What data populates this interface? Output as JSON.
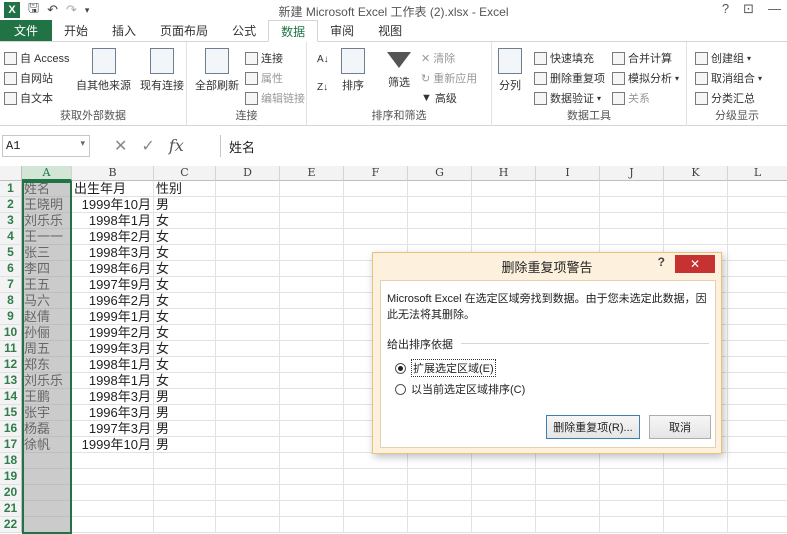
{
  "app": {
    "title": "新建 Microsoft Excel 工作表 (2).xlsx - Excel",
    "logo": "X",
    "window_controls": [
      "?",
      "⊡",
      "—"
    ]
  },
  "qat": {
    "save_icon": "save-icon",
    "undo_icon": "undo-icon",
    "redo_icon": "redo-icon",
    "customize_icon": "customize-qat-icon"
  },
  "tabs": [
    {
      "label": "文件"
    },
    {
      "label": "开始"
    },
    {
      "label": "插入"
    },
    {
      "label": "页面布局"
    },
    {
      "label": "公式"
    },
    {
      "label": "数据"
    },
    {
      "label": "审阅"
    },
    {
      "label": "视图"
    }
  ],
  "ribbon": {
    "external": {
      "from_access": "自 Access",
      "from_web": "自网站",
      "from_text": "自文本",
      "other_sources": "自其他来源",
      "existing_conn": "现有连接",
      "label": "获取外部数据"
    },
    "connections": {
      "refresh_all": "全部刷新",
      "connections": "连接",
      "properties": "属性",
      "edit_links": "编辑链接",
      "label": "连接"
    },
    "sort_filter": {
      "sort": "排序",
      "filter": "筛选",
      "clear": "清除",
      "reapply": "重新应用",
      "advanced": "高级",
      "label": "排序和筛选"
    },
    "data_tools": {
      "text_to_columns": "分列",
      "flash_fill": "快速填充",
      "remove_duplicates": "删除重复项",
      "data_validation": "数据验证",
      "consolidate": "合并计算",
      "what_if": "模拟分析",
      "relationships": "关系",
      "label": "数据工具"
    },
    "outline": {
      "group": "创建组",
      "ungroup": "取消组合",
      "subtotal": "分类汇总",
      "label": "分级显示"
    }
  },
  "formula_bar": {
    "name_box": "A1",
    "fx": "fx",
    "content": "姓名"
  },
  "columns": [
    "A",
    "B",
    "C",
    "D",
    "E",
    "F",
    "G",
    "H",
    "I",
    "J",
    "K",
    "L"
  ],
  "rows": [
    {
      "n": "1",
      "a": "姓名",
      "b": "出生年月",
      "c": "性别"
    },
    {
      "n": "2",
      "a": "王晓明",
      "b": "1999年10月",
      "c": "男"
    },
    {
      "n": "3",
      "a": "刘乐乐",
      "b": "1998年1月",
      "c": "女"
    },
    {
      "n": "4",
      "a": "王一一",
      "b": "1998年2月",
      "c": "女"
    },
    {
      "n": "5",
      "a": "张三",
      "b": "1998年3月",
      "c": "女"
    },
    {
      "n": "6",
      "a": "李四",
      "b": "1998年6月",
      "c": "女"
    },
    {
      "n": "7",
      "a": "王五",
      "b": "1997年9月",
      "c": "女"
    },
    {
      "n": "8",
      "a": "马六",
      "b": "1996年2月",
      "c": "女"
    },
    {
      "n": "9",
      "a": "赵倩",
      "b": "1999年1月",
      "c": "女"
    },
    {
      "n": "10",
      "a": "孙俪",
      "b": "1999年2月",
      "c": "女"
    },
    {
      "n": "11",
      "a": "周五",
      "b": "1999年3月",
      "c": "女"
    },
    {
      "n": "12",
      "a": "郑东",
      "b": "1998年1月",
      "c": "女"
    },
    {
      "n": "13",
      "a": "刘乐乐",
      "b": "1998年1月",
      "c": "女"
    },
    {
      "n": "14",
      "a": "王鹏",
      "b": "1998年3月",
      "c": "男"
    },
    {
      "n": "15",
      "a": "张宇",
      "b": "1996年3月",
      "c": "男"
    },
    {
      "n": "16",
      "a": "杨磊",
      "b": "1997年3月",
      "c": "男"
    },
    {
      "n": "17",
      "a": "徐帆",
      "b": "1999年10月",
      "c": "男"
    },
    {
      "n": "18",
      "a": "",
      "b": "",
      "c": ""
    },
    {
      "n": "19",
      "a": "",
      "b": "",
      "c": ""
    },
    {
      "n": "20",
      "a": "",
      "b": "",
      "c": ""
    },
    {
      "n": "21",
      "a": "",
      "b": "",
      "c": ""
    },
    {
      "n": "22",
      "a": "",
      "b": "",
      "c": ""
    }
  ],
  "dialog": {
    "title": "删除重复项警告",
    "help": "?",
    "close": "✕",
    "message": "Microsoft Excel 在选定区域旁找到数据。由于您未选定此数据，因此无法将其删除。",
    "section_label": "给出排序依据",
    "option_expand": "扩展选定区域(E)",
    "option_current": "以当前选定区域排序(C)",
    "remove_button": "删除重复项(R)...",
    "cancel_button": "取消"
  },
  "colors": {
    "excel_green": "#217346",
    "dialog_frame": "#fdf1dd",
    "close_red": "#c63232"
  }
}
